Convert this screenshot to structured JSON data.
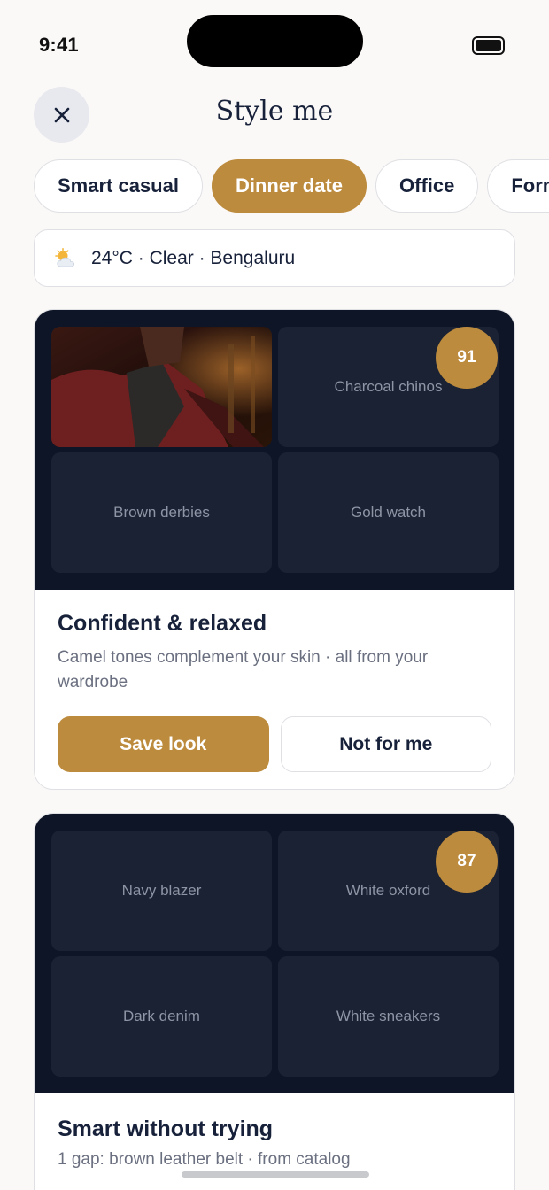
{
  "status": {
    "time": "9:41"
  },
  "header": {
    "title": "Style me"
  },
  "chips": [
    {
      "label": "Smart casual",
      "active": false
    },
    {
      "label": "Dinner date",
      "active": true
    },
    {
      "label": "Office",
      "active": false
    },
    {
      "label": "Formal",
      "active": false
    }
  ],
  "weather": {
    "icon": "partly-cloudy-icon",
    "text": "24°C · Clear · Bengaluru"
  },
  "looks": [
    {
      "score": "91",
      "tiles": [
        "",
        "Charcoal chinos",
        "Brown derbies",
        "Gold watch"
      ],
      "title": "Confident & relaxed",
      "subtitle": "Camel tones complement your skin · all from your wardrobe",
      "save_label": "Save look",
      "reject_label": "Not for me"
    },
    {
      "score": "87",
      "tiles": [
        "Navy blazer",
        "White oxford",
        "Dark denim",
        "White sneakers"
      ],
      "title": "Smart without trying",
      "subtitle": "1 gap: brown leather belt · from catalog"
    }
  ],
  "colors": {
    "accent": "#bc8b3d",
    "dark_panel": "#0d1526",
    "tile": "#1a2233",
    "text": "#17213a",
    "muted": "#6b7080"
  }
}
